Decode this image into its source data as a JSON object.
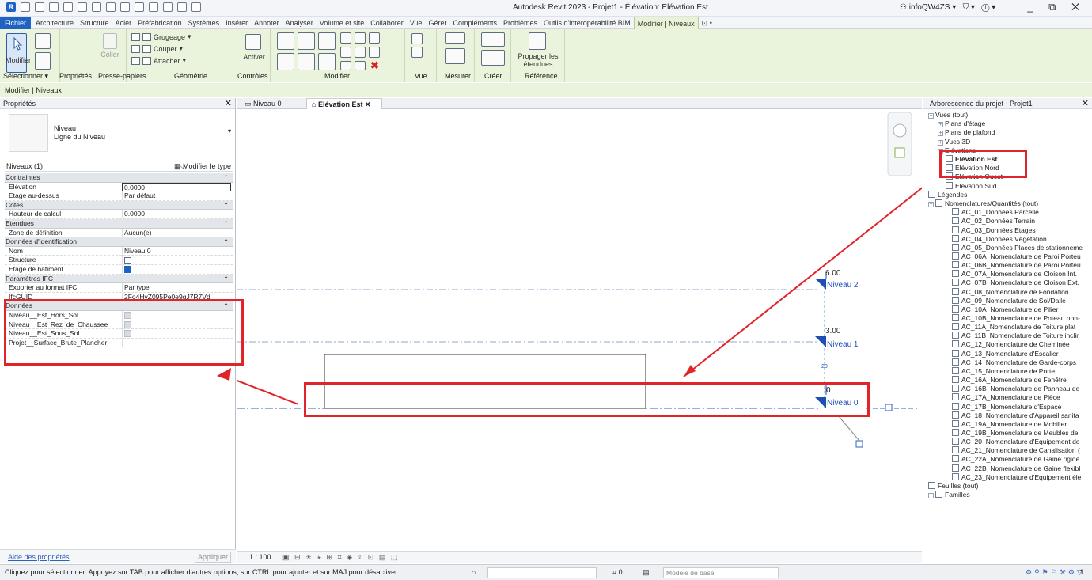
{
  "app": {
    "title": "Autodesk Revit 2023 - Projet1 - Élévation: Elévation Est",
    "user": "infoQW4ZS",
    "window_controls": "_ ⧉ ✕"
  },
  "menu": {
    "file": "Fichier",
    "tabs": [
      "Architecture",
      "Structure",
      "Acier",
      "Préfabrication",
      "Systèmes",
      "Insérer",
      "Annoter",
      "Analyser",
      "Volume et site",
      "Collaborer",
      "Vue",
      "Gérer",
      "Compléments",
      "Problèmes",
      "Outils d'interopérabilité BIM",
      "Modifier | Niveaux"
    ],
    "extra": "⊡ •"
  },
  "ribbon": {
    "modifier": "Modifier",
    "coller": "Coller",
    "grugeage": "Grugeage",
    "couper": "Couper",
    "attacher": "Attacher",
    "activer": "Activer",
    "propager": "Propager les étendues",
    "groups": {
      "selectionner": "Sélectionner ▾",
      "proprietes": "Propriétés",
      "presse_papiers": "Presse-papiers",
      "geometrie": "Géométrie",
      "controles": "Contrôles",
      "modifier": "Modifier",
      "vue": "Vue",
      "mesurer": "Mesurer",
      "creer": "Créer",
      "reference": "Référence"
    }
  },
  "context_bar": "Modifier | Niveaux",
  "properties": {
    "title": "Propriétés",
    "type_line1": "Niveau",
    "type_line2": "Ligne du Niveau",
    "instance": "Niveaux (1)",
    "edit_type": "Modifier le type",
    "rows": [
      {
        "cat": true,
        "name": "Contraintes"
      },
      {
        "name": "Elévation",
        "value": "0.0000",
        "edit": true
      },
      {
        "name": "Etage au-dessus",
        "value": "Par défaut"
      },
      {
        "cat": true,
        "name": "Cotes"
      },
      {
        "name": "Hauteur de calcul",
        "value": "0.0000"
      },
      {
        "cat": true,
        "name": "Etendues"
      },
      {
        "name": "Zone de définition",
        "value": "Aucun(e)"
      },
      {
        "cat": true,
        "name": "Données d'identification"
      },
      {
        "name": "Nom",
        "value": "Niveau 0"
      },
      {
        "name": "Structure",
        "check": "off"
      },
      {
        "name": "Etage de bâtiment",
        "check": "on"
      },
      {
        "cat": true,
        "name": "Paramètres IFC"
      },
      {
        "name": "Exporter au format IFC",
        "value": "Par type"
      },
      {
        "name": "IfcGUID",
        "value": "2Fo4HvZ095Pe0e9gJ7R7Vd"
      },
      {
        "cat": true,
        "name": "Données"
      },
      {
        "name": "Niveau__Est_Hors_Sol",
        "check": "grey"
      },
      {
        "name": "Niveau__Est_Rez_de_Chaussee",
        "check": "grey"
      },
      {
        "name": "Niveau__Est_Sous_Sol",
        "check": "grey"
      },
      {
        "name": "Projet__Surface_Brute_Plancher",
        "value": ""
      }
    ],
    "help": "Aide des propriétés",
    "apply": "Appliquer"
  },
  "views": {
    "tabs": [
      "Niveau 0",
      "Elévation Est"
    ],
    "scale": "1 : 100",
    "levels": [
      {
        "elev": "6.00",
        "name": "Niveau 2"
      },
      {
        "elev": "3.00",
        "name": "Niveau 1"
      },
      {
        "elev": "0",
        "name": "Niveau 0"
      }
    ],
    "dim": "20"
  },
  "browser": {
    "title": "Arborescence du projet - Projet1",
    "root": "Vues (tout)",
    "items": [
      "Plans d'étage",
      "Plans de plafond",
      "Vues 3D",
      "Elévations",
      "Elévation Est",
      "Elévation Nord",
      "Elévation Ouest",
      "Elévation Sud",
      "Légendes",
      "Nomenclatures/Quantités (tout)"
    ],
    "schedules": [
      "AC_01_Données Parcelle",
      "AC_02_Données Terrain",
      "AC_03_Données Etages",
      "AC_04_Données Végétation",
      "AC_05_Données Places de stationneme",
      "AC_06A_Nomenclature de Paroi Porteu",
      "AC_06B_Nomenclature de Paroi Porteu",
      "AC_07A_Nomenclature de Cloison Int.",
      "AC_07B_Nomenclature de Cloison Ext.",
      "AC_08_Nomenclature de Fondation",
      "AC_09_Nomenclature de Sol/Dalle",
      "AC_10A_Nomenclature de Pilier",
      "AC_10B_Nomenclature de Poteau non-",
      "AC_11A_Nomenclature de Toiture plat",
      "AC_11B_Nomenclature de Toiture inclir",
      "AC_12_Nomenclature de Cheminée",
      "AC_13_Nomenclature d'Escalier",
      "AC_14_Nomenclature de Garde-corps",
      "AC_15_Nomenclature de Porte",
      "AC_16A_Nomenclature de Fenêtre",
      "AC_16B_Nomenclature de Panneau de",
      "AC_17A_Nomenclature de Pièce",
      "AC_17B_Nomenclature d'Espace",
      "AC_18_Nomenclature d'Appareil sanita",
      "AC_19A_Nomenclature de Mobilier",
      "AC_19B_Nomenclature de Meubles de",
      "AC_20_Nomenclature d'Equipement de",
      "AC_21_Nomenclature de Canalisation (",
      "AC_22A_Nomenclature de Gaine rigide",
      "AC_22B_Nomenclature de Gaine flexibl",
      "AC_23_Nomenclature d'Equipement éle"
    ],
    "after": [
      "Feuilles (tout)",
      "Familles"
    ]
  },
  "status": {
    "message": "Cliquez pour sélectionner. Appuyez sur TAB pour afficher d'autres options, sur CTRL pour ajouter et sur MAJ pour désactiver.",
    "count": ":0",
    "model": "Modèle de base",
    "filter": ":1"
  },
  "colors": {
    "annotation_red": "#e0242a",
    "level_blue": "#1e4fb5",
    "file_tab": "#1e63c4",
    "ribbon_bg": "#eaf3dc"
  }
}
